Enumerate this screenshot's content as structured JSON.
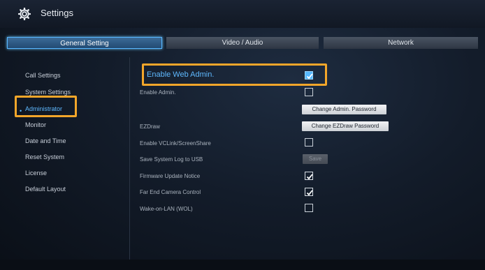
{
  "window": {
    "title": "Settings"
  },
  "tabs": [
    {
      "label": "General Setting",
      "active": true
    },
    {
      "label": "Video / Audio",
      "active": false
    },
    {
      "label": "Network",
      "active": false
    }
  ],
  "sidebar": {
    "items": [
      {
        "label": "Call Settings"
      },
      {
        "label": "System Settings"
      },
      {
        "label": "Administrator",
        "active": true
      },
      {
        "label": "Monitor"
      },
      {
        "label": "Date and Time"
      },
      {
        "label": "Reset System"
      },
      {
        "label": "License"
      },
      {
        "label": "Default Layout"
      }
    ]
  },
  "settings": {
    "enable_web_admin": {
      "label": "Enable Web Admin.",
      "checked": true
    },
    "enable_admin": {
      "label": "Enable Admin.",
      "checked": false
    },
    "change_admin_password": {
      "label": "Change Admin. Password"
    },
    "ezdraw": {
      "label": "EZDraw",
      "button": "Change EZDraw Password"
    },
    "enable_vclink": {
      "label": "Enable VCLink/ScreenShare",
      "checked": false
    },
    "save_log": {
      "label": "Save System Log to USB",
      "button": "Save"
    },
    "firmware_notice": {
      "label": "Firmware Update Notice",
      "checked": true
    },
    "far_end_camera": {
      "label": "Far End Camera Control",
      "checked": true
    },
    "wake_on_lan": {
      "label": "Wake-on-LAN (WOL)",
      "checked": false
    }
  },
  "colors": {
    "accent": "#5fb9ff",
    "highlight": "#f3a62a"
  },
  "icons": {
    "title": "gear-icon",
    "check": "checkmark-icon"
  }
}
